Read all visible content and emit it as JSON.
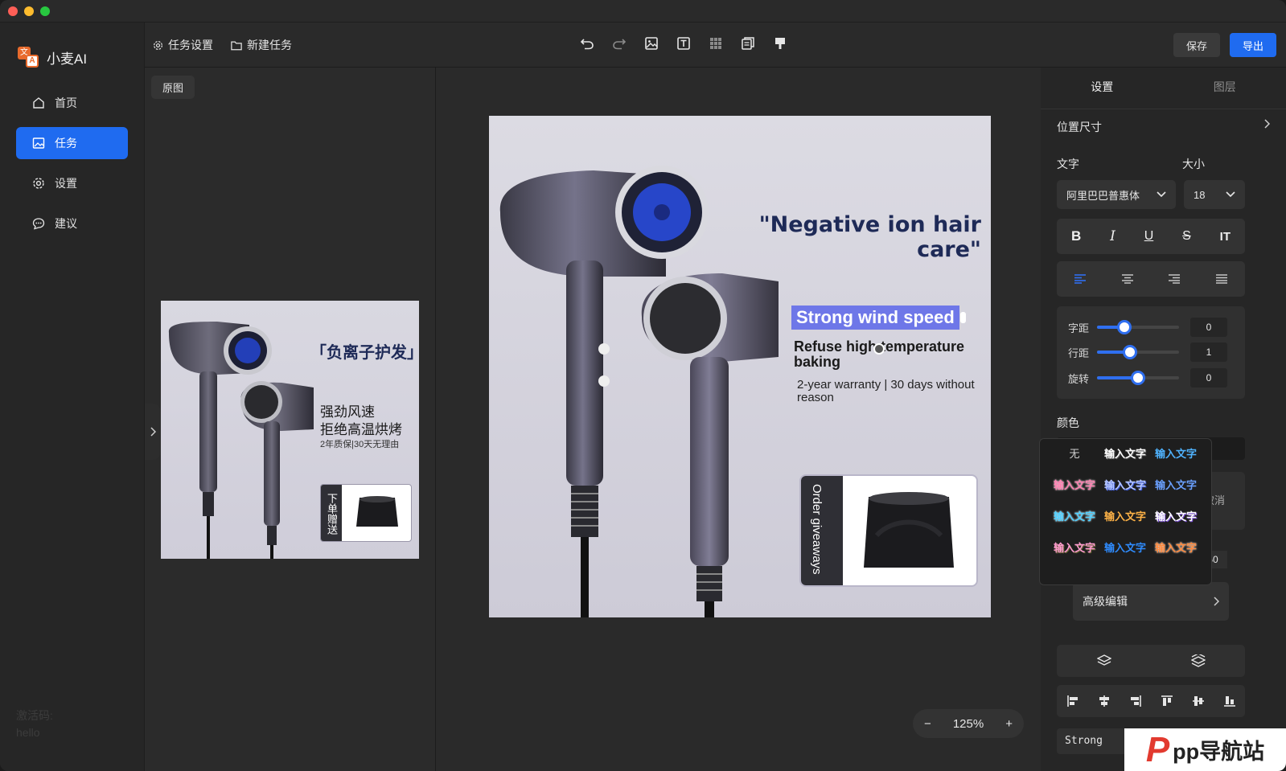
{
  "app": {
    "name": "小麦AI",
    "activation_label": "激活码:",
    "activation_code": "hello"
  },
  "sidebar": {
    "items": [
      {
        "label": "首页",
        "icon": "home-icon",
        "active": false
      },
      {
        "label": "任务",
        "icon": "image-icon",
        "active": true
      },
      {
        "label": "设置",
        "icon": "gear-icon",
        "active": false
      },
      {
        "label": "建议",
        "icon": "chat-icon",
        "active": false
      }
    ]
  },
  "toolbar": {
    "task_settings": "任务设置",
    "new_task": "新建任务",
    "save": "保存",
    "export": "导出",
    "tools": [
      "undo-icon",
      "redo-icon",
      "image-icon",
      "text-icon",
      "mosaic-icon",
      "copy-icon",
      "paint-brush-icon"
    ]
  },
  "left_panel": {
    "tag": "原图",
    "thumbnail": {
      "headline": "「负离子护发」",
      "line1": "强劲风速",
      "line2": "拒绝高温烘烤",
      "line3": "2年质保|30天无理由",
      "giveaway": "下单赠送"
    }
  },
  "canvas": {
    "headline": "\"Negative ion hair care\"",
    "selected_text": "Strong wind speed",
    "sub1": "Refuse high temperature baking",
    "sub2": "2-year warranty | 30 days without reason",
    "giveaway": "Order giveaways",
    "zoom": "125%",
    "zoom_out": "−",
    "zoom_in": "+"
  },
  "right_panel": {
    "tabs": [
      "设置",
      "图层"
    ],
    "position_size": "位置尺寸",
    "text_label": "文字",
    "size_label": "大小",
    "font": "阿里巴巴普惠体",
    "font_size": "18",
    "letter_spacing_label": "字距",
    "letter_spacing": "0",
    "line_spacing_label": "行距",
    "line_spacing": "1",
    "rotation_label": "旋转",
    "rotation": "0",
    "color_label": "颜色",
    "cancel": "取消",
    "effect_value": "50",
    "advanced_edit": "高级编辑",
    "text_field": "Strong"
  },
  "presets": {
    "none": "无",
    "sample": "输入文字",
    "colors": [
      "#ffffff",
      "#4fb3ff",
      "#ff7fb0",
      "#6aa0ff",
      "#5a9bff",
      "#4fd0ff",
      "#ffb347",
      "#ff6fa8",
      "#b08cff",
      "#2f8cff",
      "#ff8a3d"
    ]
  },
  "watermark": {
    "p": "P",
    "text": "pp导航站"
  }
}
